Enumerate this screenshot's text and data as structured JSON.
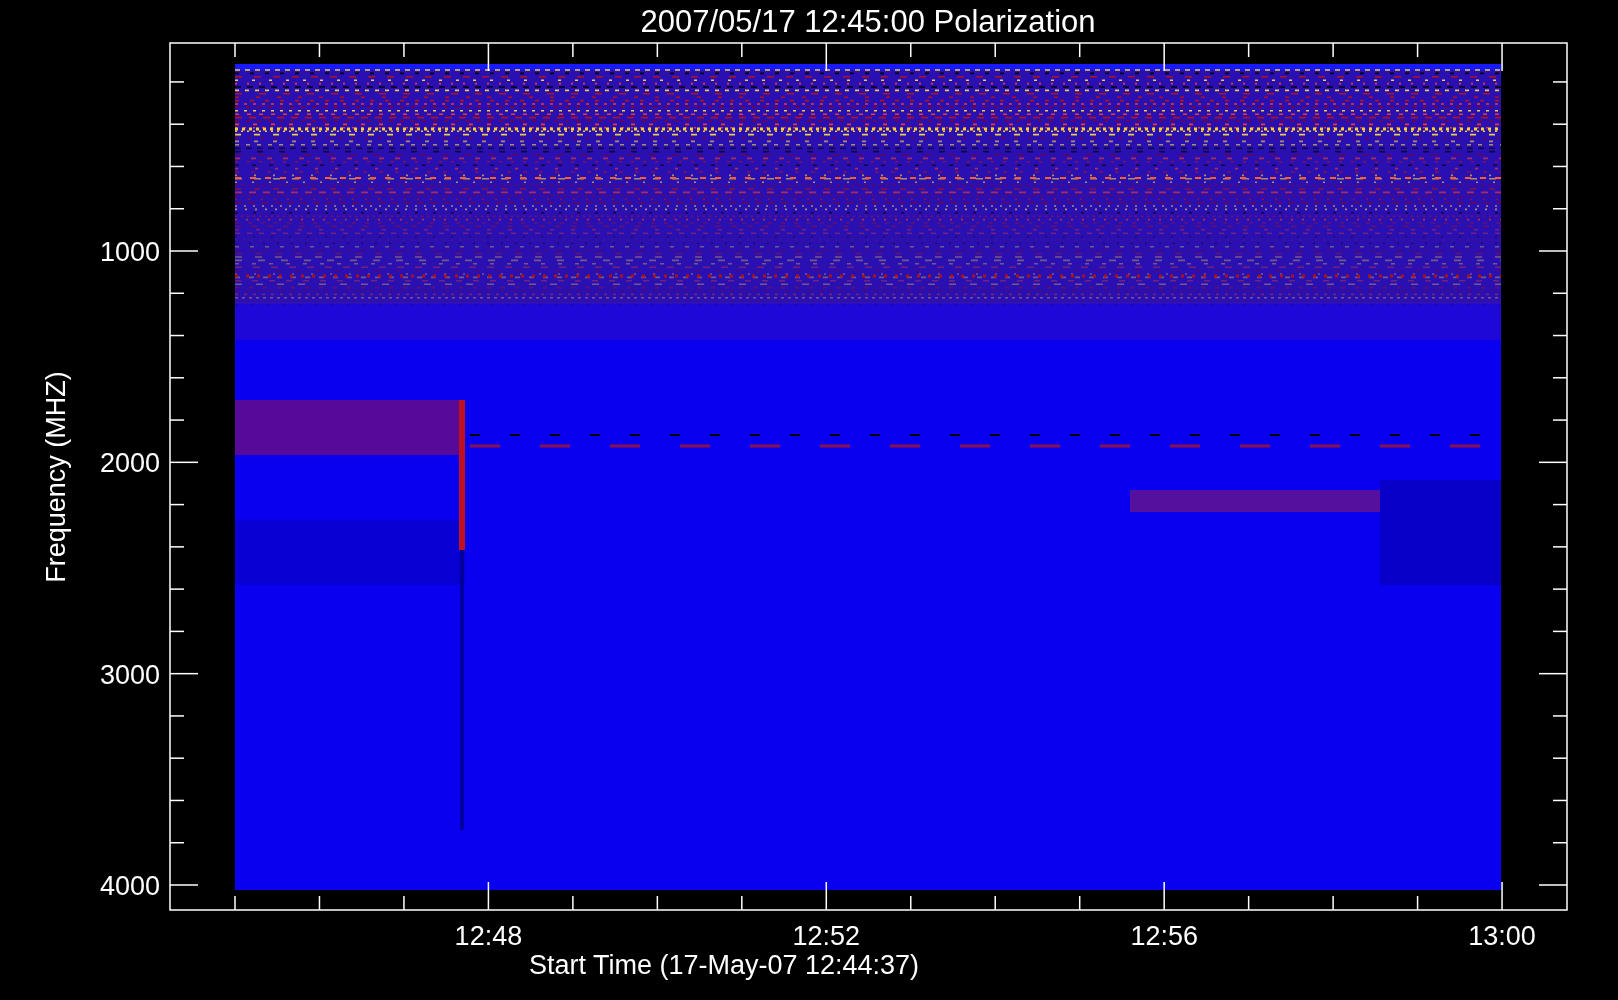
{
  "chart": {
    "title": "2007/05/17 12:45:00 Polarization",
    "ylabel": "Frequency (MHZ)",
    "xlabel": "Start Time (17-May-07 12:44:37)",
    "yticks": [
      "1000",
      "2000",
      "3000",
      "4000"
    ],
    "xticks": [
      "12:48",
      "12:52",
      "12:56",
      "13:00"
    ]
  }
}
